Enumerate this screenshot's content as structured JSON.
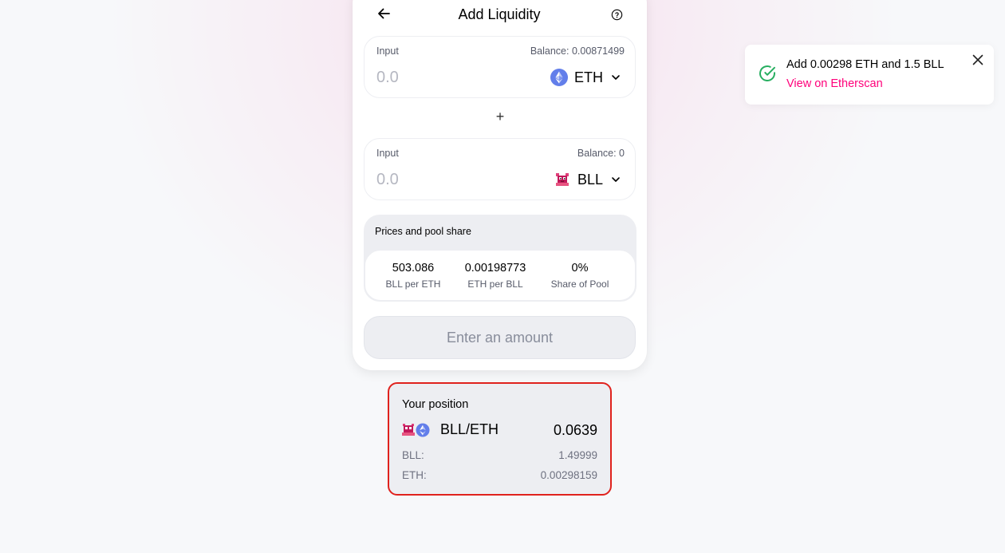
{
  "header": {
    "title": "Add Liquidity",
    "back_icon": "arrow-left-icon",
    "help_icon": "question-circle-icon"
  },
  "input_a": {
    "label": "Input",
    "balance": "Balance: 0.00871499",
    "amount_placeholder": "0.0",
    "token": "ETH",
    "token_icon": "eth-icon"
  },
  "plus_sign": "+",
  "input_b": {
    "label": "Input",
    "balance": "Balance: 0",
    "amount_placeholder": "0.0",
    "token": "BLL",
    "token_icon": "bll-icon"
  },
  "prices": {
    "title": "Prices and pool share",
    "stats": [
      {
        "value": "503.086",
        "label": "BLL per ETH"
      },
      {
        "value": "0.00198773",
        "label": "ETH per BLL"
      },
      {
        "value": "0%",
        "label": "Share of Pool"
      }
    ]
  },
  "cta": {
    "label": "Enter an amount"
  },
  "position": {
    "title": "Your position",
    "pair": "BLL/ETH",
    "pool_tokens": "0.0639",
    "rows": [
      {
        "label": "BLL:",
        "value": "1.49999"
      },
      {
        "label": "ETH:",
        "value": "0.00298159"
      }
    ]
  },
  "toast": {
    "message": "Add 0.00298 ETH and 1.5 BLL",
    "link": "View on Etherscan",
    "status_icon": "check-circle-icon",
    "close_icon": "close-icon"
  },
  "colors": {
    "accent_pink": "#ff007a",
    "success_green": "#27ae60",
    "eth_blue": "#627eea",
    "highlight_red": "#e0221d"
  }
}
